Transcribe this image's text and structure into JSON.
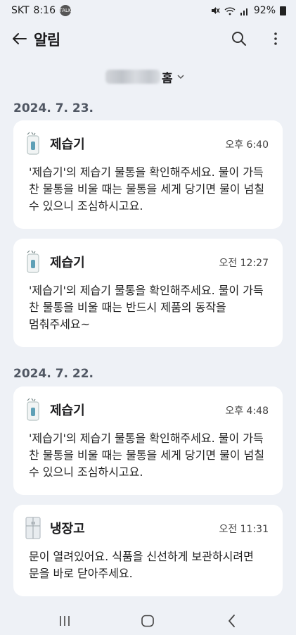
{
  "status_bar": {
    "carrier": "SKT",
    "time": "8:16",
    "battery": "92%"
  },
  "app_bar": {
    "title": "알림"
  },
  "home_selector": {
    "label": "홈"
  },
  "groups": [
    {
      "date": "2024. 7. 23.",
      "notifications": [
        {
          "device": "제습기",
          "device_icon": "dehumidifier-icon",
          "time": "오후 6:40",
          "message": "'제습기'의 제습기 물통을 확인해주세요. 물이 가득 찬 물통을 비울 때는 물통을 세게 당기면 물이 넘칠 수 있으니 조심하시고요."
        },
        {
          "device": "제습기",
          "device_icon": "dehumidifier-icon",
          "time": "오전 12:27",
          "message": "'제습기'의 제습기 물통을 확인해주세요. 물이 가득 찬 물통을 비울 때는 반드시 제품의 동작을 멈춰주세요~"
        }
      ]
    },
    {
      "date": "2024. 7. 22.",
      "notifications": [
        {
          "device": "제습기",
          "device_icon": "dehumidifier-icon",
          "time": "오후 4:48",
          "message": "'제습기'의 제습기 물통을 확인해주세요. 물이 가득 찬 물통을 비울 때는 물통을 세게 당기면 물이 넘칠 수 있으니 조심하시고요."
        },
        {
          "device": "냉장고",
          "device_icon": "refrigerator-icon",
          "time": "오전 11:31",
          "message": "문이 열려있어요. 식품을 신선하게 보관하시려면 문을 바로 닫아주세요."
        }
      ]
    }
  ],
  "colors": {
    "background": "#eef1f6",
    "card": "#ffffff",
    "date_header": "#505763"
  }
}
